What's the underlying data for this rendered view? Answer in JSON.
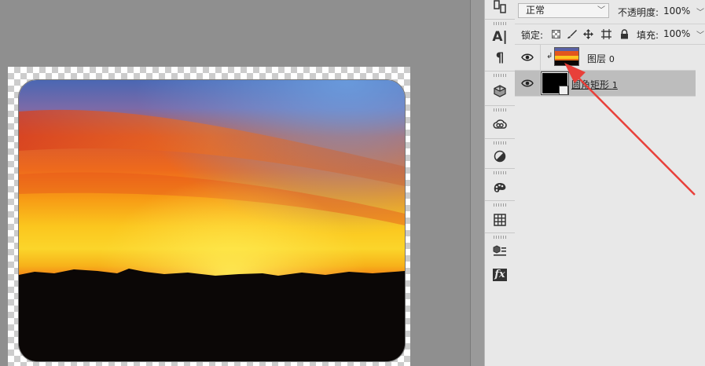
{
  "layers_panel": {
    "blend_mode": "正常",
    "opacity_label": "不透明度:",
    "opacity_value": "100%",
    "lock_label": "锁定:",
    "fill_label": "填充:",
    "fill_value": "100%",
    "layers": [
      {
        "name": "图层",
        "suffix": "0",
        "visible": true,
        "clipped": true,
        "selected": false
      },
      {
        "name": "圆角矩形",
        "suffix": "1",
        "visible": true,
        "clipped": false,
        "selected": true
      }
    ]
  },
  "toolstrip": {
    "tools": [
      "link-layers-icon",
      "character-icon",
      "paragraph-icon",
      "3d-cube-icon",
      "creative-cloud-icon",
      "adjustments-icon",
      "swatches-icon",
      "grid-icon",
      "properties-icon",
      "fx-icon"
    ]
  },
  "annotation": {
    "color": "#e8403a"
  }
}
